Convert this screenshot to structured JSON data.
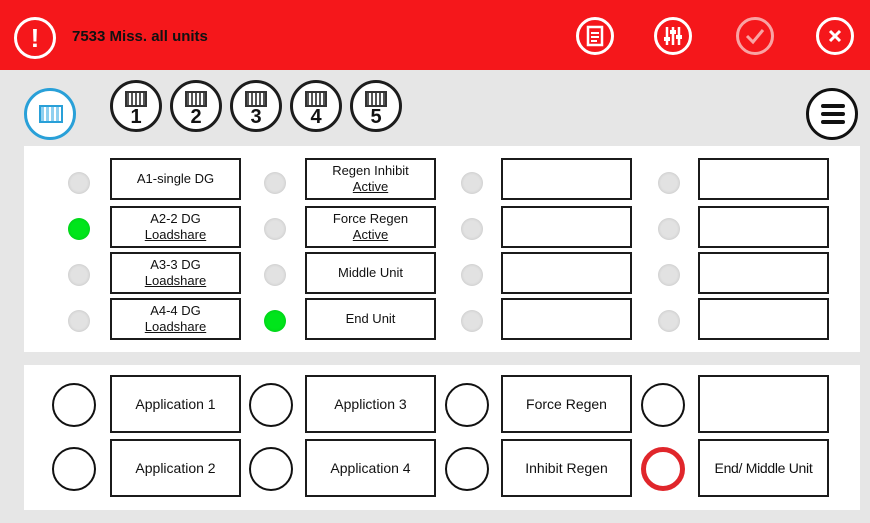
{
  "header": {
    "alert_glyph": "!",
    "title": "7533 Miss. all units",
    "buttons": [
      {
        "name": "document-icon"
      },
      {
        "name": "sliders-icon"
      },
      {
        "name": "checkmark-icon"
      },
      {
        "name": "close-icon"
      }
    ]
  },
  "toolbar": {
    "unit_buttons": [
      "1",
      "2",
      "3",
      "4",
      "5"
    ]
  },
  "status_panel": {
    "col1": [
      {
        "text": "A1-single DG",
        "on": false
      },
      {
        "line1": "A2-2 DG",
        "line2": "Loadshare",
        "on": true
      },
      {
        "line1": "A3-3 DG",
        "line2": "Loadshare",
        "on": false
      },
      {
        "line1": "A4-4 DG",
        "line2": "Loadshare",
        "on": false
      }
    ],
    "col2": [
      {
        "line1": "Regen Inhibit",
        "line2": "Active",
        "on": false
      },
      {
        "line1": "Force Regen",
        "line2": "Active",
        "on": false
      },
      {
        "text": "Middle Unit",
        "on": false
      },
      {
        "text": "End Unit",
        "on": true
      }
    ]
  },
  "command_panel": {
    "row1": [
      "Application 1",
      "Appliction 3",
      "Force Regen",
      ""
    ],
    "row2": [
      "Application 2",
      "Application 4",
      "Inhibit Regen",
      "End/ Middle Unit"
    ]
  },
  "colors": {
    "header_red": "#f5171b",
    "led_on": "#00e51b",
    "active_ring": "#e0262b",
    "selected_blue": "#29a0d8"
  }
}
